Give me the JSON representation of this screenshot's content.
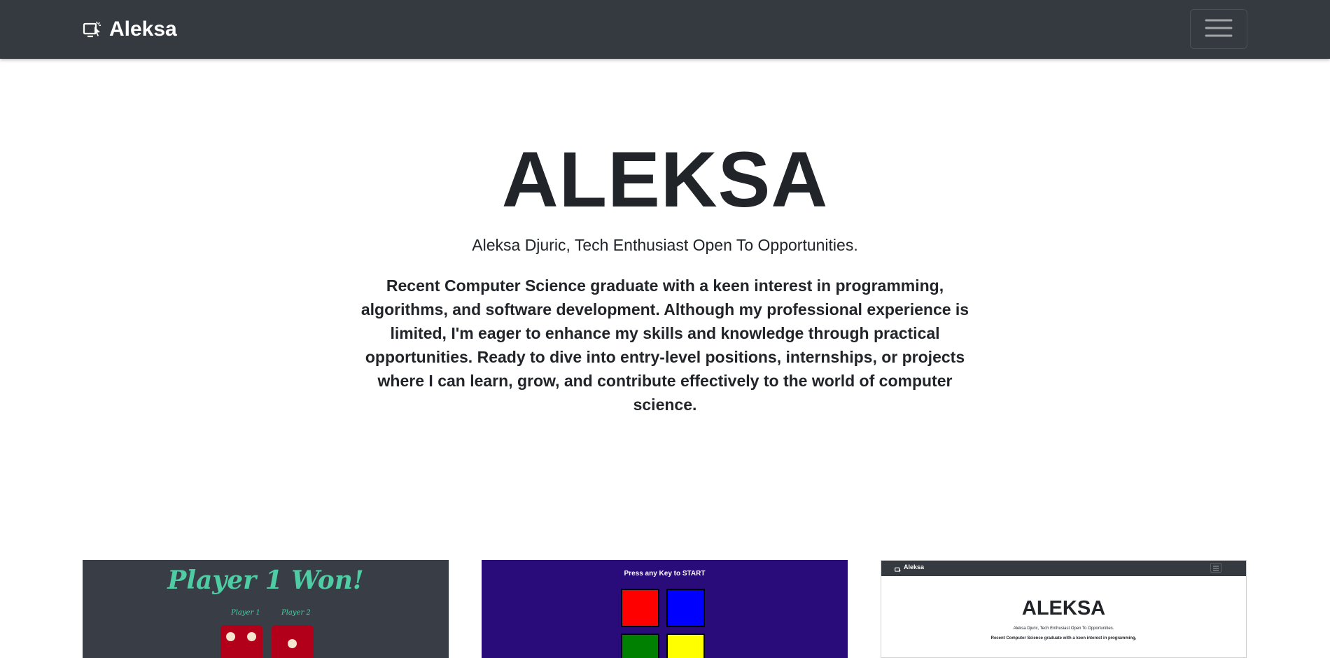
{
  "navbar": {
    "brand": "Aleksa",
    "brand_icon": "laptop-pointer-icon",
    "toggler_icon": "hamburger-menu-icon",
    "background": "#343a40"
  },
  "hero": {
    "title": "ALEKSA",
    "subtitle": "Aleksa Djuric, Tech Enthusiast Open To Opportunities.",
    "description": "Recent Computer Science graduate with a keen interest in programming, algorithms, and software development. Although my professional experience is limited, I'm eager to enhance my skills and knowledge through practical opportunities. Ready to dive into entry-level positions, internships, or projects where I can learn, grow, and contribute effectively to the world of computer science."
  },
  "projects": [
    {
      "title": "Player 1 Won!",
      "player1_label": "Player 1",
      "player2_label": "Player 2",
      "accent": "#4ecca3",
      "background": "#393e46"
    },
    {
      "title": "Press any Key to START",
      "pad_colors": [
        "#ff0000",
        "#0000ff",
        "#008000",
        "#ffff00"
      ],
      "background": "#2a0b7a"
    },
    {
      "brand": "Aleksa",
      "title": "ALEKSA",
      "subtitle": "Aleksa Djuric, Tech Enthusiast Open To Opportunities.",
      "description_line": "Recent Computer Science graduate with a keen interest in programming,"
    }
  ]
}
